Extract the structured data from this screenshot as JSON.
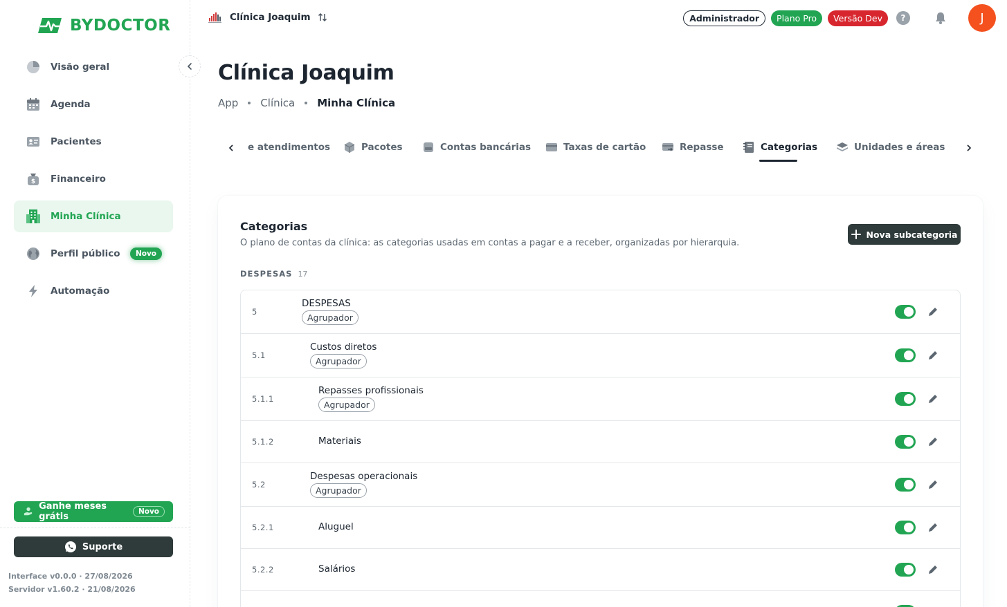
{
  "brand": {
    "name": "BYDOCTOR",
    "color": "#22a553"
  },
  "sidebar": {
    "items": [
      {
        "label": "Visão geral",
        "icon": "pie-chart-icon"
      },
      {
        "label": "Agenda",
        "icon": "calendar-icon"
      },
      {
        "label": "Pacientes",
        "icon": "id-card-icon"
      },
      {
        "label": "Financeiro",
        "icon": "money-bag-icon"
      },
      {
        "label": "Minha Clínica",
        "icon": "building-icon",
        "active": true
      },
      {
        "label": "Perfil público",
        "icon": "globe-icon",
        "badge": "Novo"
      },
      {
        "label": "Automação",
        "icon": "lightning-icon"
      }
    ],
    "earn": {
      "label": "Ganhe meses grátis",
      "badge": "Novo"
    },
    "support": {
      "label": "Suporte"
    },
    "versions": {
      "interface": "Interface v0.0.0 · 27/08/2026",
      "server": "Servidor v1.60.2 · 21/08/2026"
    }
  },
  "topbar": {
    "clinic": "Clínica Joaquim",
    "admin": "Administrador",
    "plan": "Plano Pro",
    "version": "Versão Dev",
    "help": "?",
    "avatar": "J"
  },
  "header": {
    "title": "Clínica Joaquim",
    "breadcrumb": [
      "App",
      "Clínica",
      "Minha Clínica"
    ]
  },
  "tabs": [
    {
      "label": "e atendimentos",
      "icon": ""
    },
    {
      "label": "Pacotes",
      "icon": "box-icon"
    },
    {
      "label": "Contas bancárias",
      "icon": "bank-icon"
    },
    {
      "label": "Taxas de cartão",
      "icon": "card-icon"
    },
    {
      "label": "Repasse",
      "icon": "transfer-icon"
    },
    {
      "label": "Categorias",
      "icon": "notebook-icon",
      "active": true
    },
    {
      "label": "Unidades e áreas",
      "icon": "layers-icon"
    }
  ],
  "card": {
    "title": "Categorias",
    "subtitle": "O plano de contas da clínica: as categorias usadas em contas a pagar e a receber, organizadas por hierarquia.",
    "new_button": "Nova subcategoria",
    "section": {
      "label": "DESPESAS",
      "count": "17"
    },
    "rows": [
      {
        "code": "5",
        "name": "DESPESAS",
        "tag": "Agrupador",
        "level": 0,
        "active": true
      },
      {
        "code": "5.1",
        "name": "Custos diretos",
        "tag": "Agrupador",
        "level": 1,
        "active": true
      },
      {
        "code": "5.1.1",
        "name": "Repasses profissionais",
        "tag": "Agrupador",
        "level": 2,
        "active": true
      },
      {
        "code": "5.1.2",
        "name": "Materiais",
        "tag": "",
        "level": 2,
        "active": true
      },
      {
        "code": "5.2",
        "name": "Despesas operacionais",
        "tag": "Agrupador",
        "level": 1,
        "active": true
      },
      {
        "code": "5.2.1",
        "name": "Aluguel",
        "tag": "",
        "level": 2,
        "active": true
      },
      {
        "code": "5.2.2",
        "name": "Salários",
        "tag": "",
        "level": 2,
        "active": true
      },
      {
        "code": "",
        "name": "",
        "tag": "",
        "level": 2,
        "active": true
      }
    ]
  }
}
